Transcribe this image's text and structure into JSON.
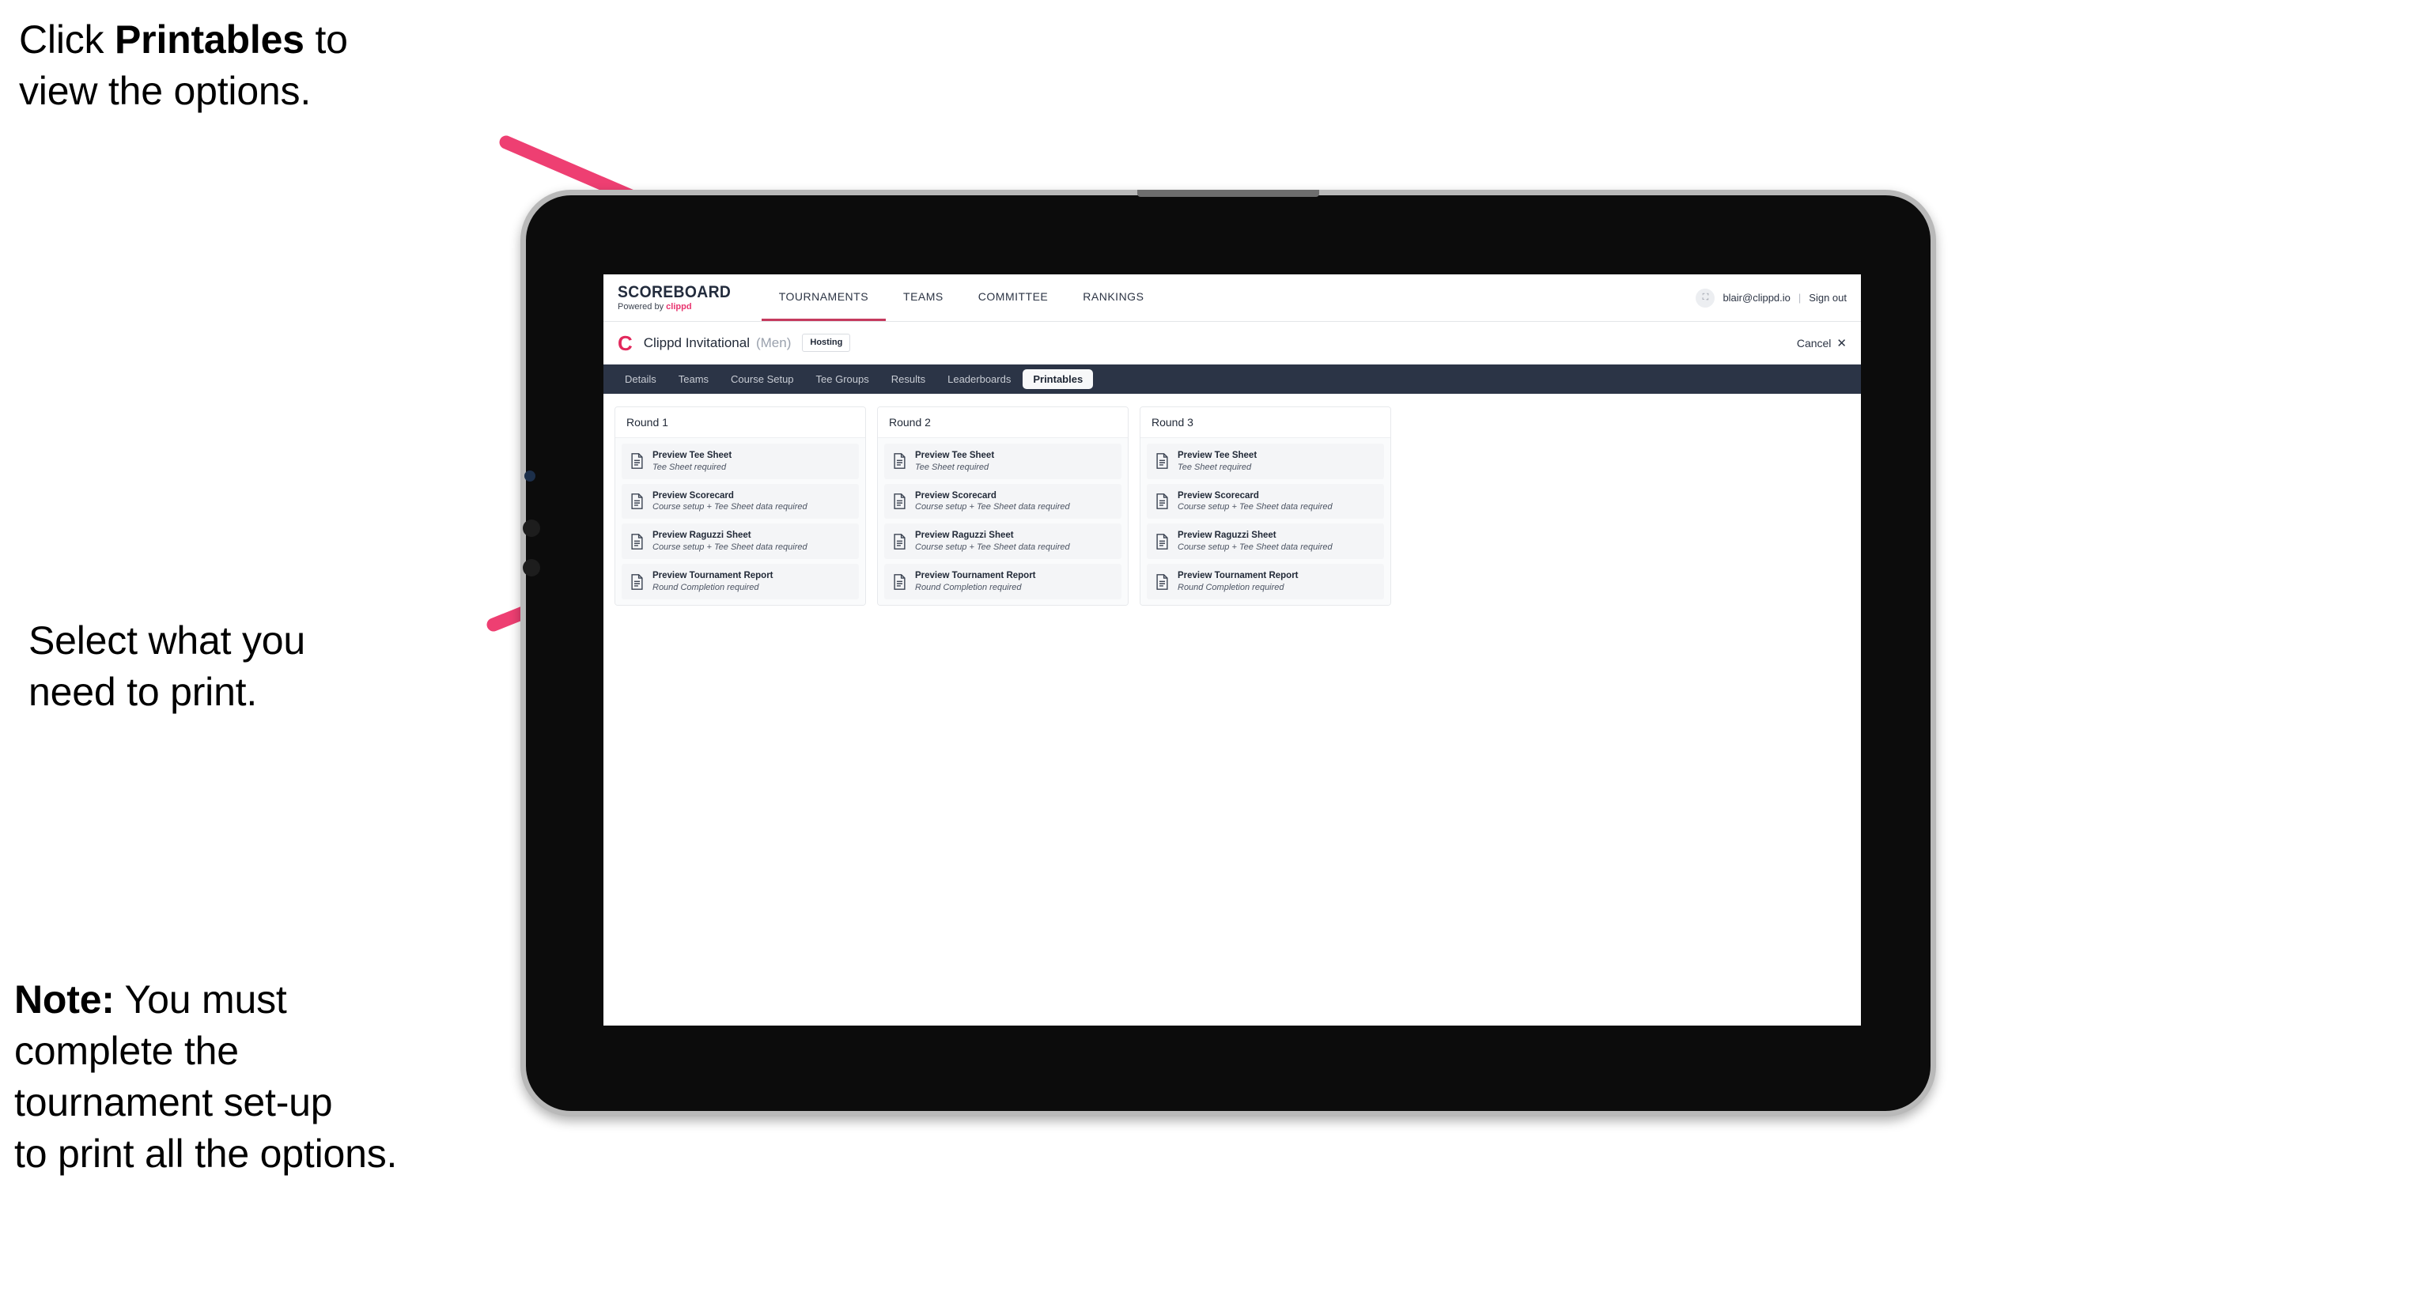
{
  "annotations": {
    "click_printables": {
      "pre": "Click ",
      "bold": "Printables",
      "post": " to\nview the options."
    },
    "select_print": "Select what you\n need to print.",
    "note": {
      "bold": "Note:",
      "rest": " You must\ncomplete the\ntournament set-up\nto print all the options."
    }
  },
  "colors": {
    "accent_pink": "#ee3f72",
    "brand_pink": "#e8336e",
    "navy": "#2b3446",
    "nav_underline": "#c53a5e"
  },
  "app": {
    "brand": {
      "title": "SCOREBOARD",
      "powered_prefix": "Powered by ",
      "powered_name": "clippd"
    },
    "main_nav": [
      {
        "label": "TOURNAMENTS",
        "active": true
      },
      {
        "label": "TEAMS",
        "active": false
      },
      {
        "label": "COMMITTEE",
        "active": false
      },
      {
        "label": "RANKINGS",
        "active": false
      }
    ],
    "account": {
      "avatar_glyph": "⛶",
      "email": "blair@clippd.io",
      "separator": "|",
      "sign_out": "Sign out"
    },
    "tournament": {
      "logo_letter": "C",
      "name": "Clippd Invitational",
      "gender": "(Men)",
      "status_badge": "Hosting",
      "cancel_label": "Cancel",
      "cancel_icon": "✕"
    },
    "tabs": [
      {
        "label": "Details",
        "active": false
      },
      {
        "label": "Teams",
        "active": false
      },
      {
        "label": "Course Setup",
        "active": false
      },
      {
        "label": "Tee Groups",
        "active": false
      },
      {
        "label": "Results",
        "active": false
      },
      {
        "label": "Leaderboards",
        "active": false
      },
      {
        "label": "Printables",
        "active": true
      }
    ],
    "rounds": [
      {
        "title": "Round 1",
        "items": [
          {
            "title": "Preview Tee Sheet",
            "sub": "Tee Sheet required"
          },
          {
            "title": "Preview Scorecard",
            "sub": "Course setup + Tee Sheet data required"
          },
          {
            "title": "Preview Raguzzi Sheet",
            "sub": "Course setup + Tee Sheet data required"
          },
          {
            "title": "Preview Tournament Report",
            "sub": "Round Completion required"
          }
        ]
      },
      {
        "title": "Round 2",
        "items": [
          {
            "title": "Preview Tee Sheet",
            "sub": "Tee Sheet required"
          },
          {
            "title": "Preview Scorecard",
            "sub": "Course setup + Tee Sheet data required"
          },
          {
            "title": "Preview Raguzzi Sheet",
            "sub": "Course setup + Tee Sheet data required"
          },
          {
            "title": "Preview Tournament Report",
            "sub": "Round Completion required"
          }
        ]
      },
      {
        "title": "Round 3",
        "items": [
          {
            "title": "Preview Tee Sheet",
            "sub": "Tee Sheet required"
          },
          {
            "title": "Preview Scorecard",
            "sub": "Course setup + Tee Sheet data required"
          },
          {
            "title": "Preview Raguzzi Sheet",
            "sub": "Course setup + Tee Sheet data required"
          },
          {
            "title": "Preview Tournament Report",
            "sub": "Round Completion required"
          }
        ]
      }
    ]
  }
}
